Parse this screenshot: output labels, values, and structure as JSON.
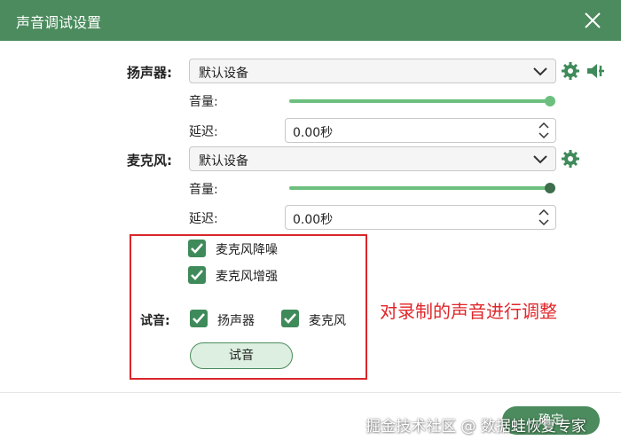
{
  "window": {
    "title": "声音调试设置"
  },
  "speaker": {
    "label": "扬声器:",
    "device": "默认设备",
    "volume_label": "音量:",
    "volume_level": 1.0,
    "delay_label": "延迟:",
    "delay_value": "0.00秒"
  },
  "mic": {
    "label": "麦克风:",
    "device": "默认设备",
    "volume_label": "音量:",
    "volume_level": 1.0,
    "delay_label": "延迟:",
    "delay_value": "0.00秒"
  },
  "options": {
    "noise_reduction": {
      "label": "麦克风降噪",
      "checked": true
    },
    "enhance": {
      "label": "麦克风增强",
      "checked": true
    }
  },
  "test": {
    "label": "试音:",
    "speaker": {
      "label": "扬声器",
      "checked": true
    },
    "mic": {
      "label": "麦克风",
      "checked": true
    },
    "button": "试音"
  },
  "annotation": "对录制的声音进行调整",
  "footer": {
    "ok_button": "确定"
  },
  "watermark": "掘金技术社区 @ 数据蛙恢复专家",
  "colors": {
    "primary": "#4b8b5d",
    "slider": "#6cbf7e",
    "annotation": "#e0262a"
  },
  "icons": {
    "gear": "gear-icon",
    "speaker_test": "speaker-icon",
    "chevron": "chevron-down-icon",
    "close": "close-icon"
  }
}
